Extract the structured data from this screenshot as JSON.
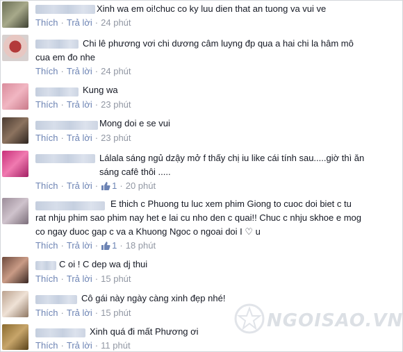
{
  "actions": {
    "like": "Thích",
    "reply": "Trả lời"
  },
  "comments": [
    {
      "text_lines": [
        "Xinh wa em oi!chuc co ky luu dien that an tuong va vui ve"
      ],
      "time": "24 phút",
      "likes": ""
    },
    {
      "text_lines": [
        "Chi lê phương vơi chi dương câm luyng đp qua a hai chi la hâm mô",
        "cua em đo nhe"
      ],
      "time": "24 phút",
      "likes": ""
    },
    {
      "text_lines": [
        "Kung wa"
      ],
      "time": "23 phút",
      "likes": ""
    },
    {
      "text_lines": [
        "Mong doi e se vui"
      ],
      "time": "23 phút",
      "likes": ""
    },
    {
      "text_lines": [
        "Lálala sáng ngủ dzậy mở f thấy chị iu like cái tính sau.....giờ thì ăn",
        "sáng cafê thôi ....."
      ],
      "time": "20 phút",
      "likes": "1"
    },
    {
      "text_lines": [
        "E thich c Phuong tu luc xem phim Giong to cuoc doi biet c tu",
        "rat nhju phim sao phim nay het e lai cu nho den c quai!! Chuc c nhju skhoe e mog",
        "co ngay duoc gap c va a Khuong Ngoc o ngoai doi I ♡ u"
      ],
      "time": "18 phút",
      "likes": "1"
    },
    {
      "text_lines": [
        "C oi ! C dep wa dj thui"
      ],
      "time": "15 phút",
      "likes": ""
    },
    {
      "text_lines": [
        "Cô gái này ngày càng xinh đẹp nhé!"
      ],
      "time": "15 phút",
      "likes": ""
    },
    {
      "text_lines": [
        "Xinh quá đi mất Phương ơi"
      ],
      "time": "11 phút",
      "likes": ""
    }
  ],
  "watermark": {
    "text": "NGOISAO.VN"
  },
  "colors": {
    "link": "#6d84b4",
    "meta": "#9197a3",
    "text": "#141823"
  }
}
